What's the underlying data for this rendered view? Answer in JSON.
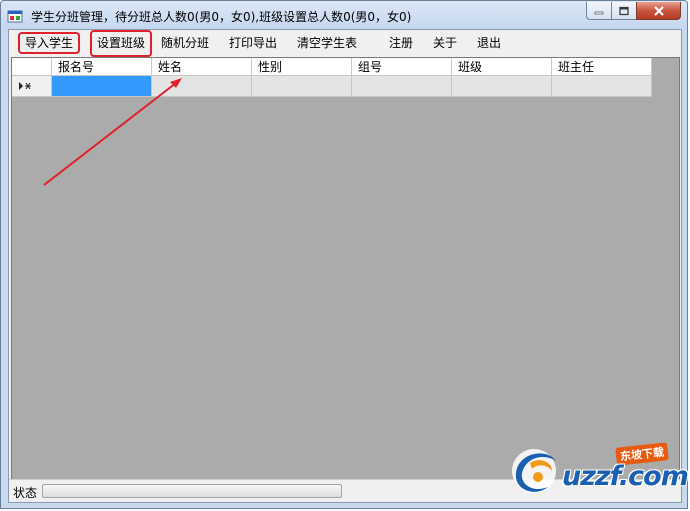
{
  "window": {
    "title": "学生分班管理，待分班总人数0(男0，女0),班级设置总人数0(男0，女0)"
  },
  "menu": {
    "items": [
      {
        "label": "导入学生",
        "highlighted": true
      },
      {
        "label": "设置班级",
        "highlighted": true
      },
      {
        "label": "随机分班",
        "highlighted": false
      },
      {
        "label": "打印导出",
        "highlighted": false
      },
      {
        "label": "清空学生表",
        "highlighted": false
      },
      {
        "label": "注册",
        "highlighted": false
      },
      {
        "label": "关于",
        "highlighted": false
      },
      {
        "label": "退出",
        "highlighted": false
      }
    ]
  },
  "grid": {
    "columns": [
      "报名号",
      "姓名",
      "性别",
      "组号",
      "班级",
      "班主任"
    ],
    "rows": [
      {
        "is_new_row": true,
        "cells": [
          "",
          "",
          "",
          "",
          "",
          ""
        ]
      }
    ]
  },
  "statusbar": {
    "label": "状态",
    "progress": 0
  },
  "watermark": {
    "brand": "uzzf.com",
    "tag": "东坡下载"
  },
  "colors": {
    "highlight": "#e0202a",
    "selection": "#3399ff",
    "grid_background": "#ababab"
  }
}
